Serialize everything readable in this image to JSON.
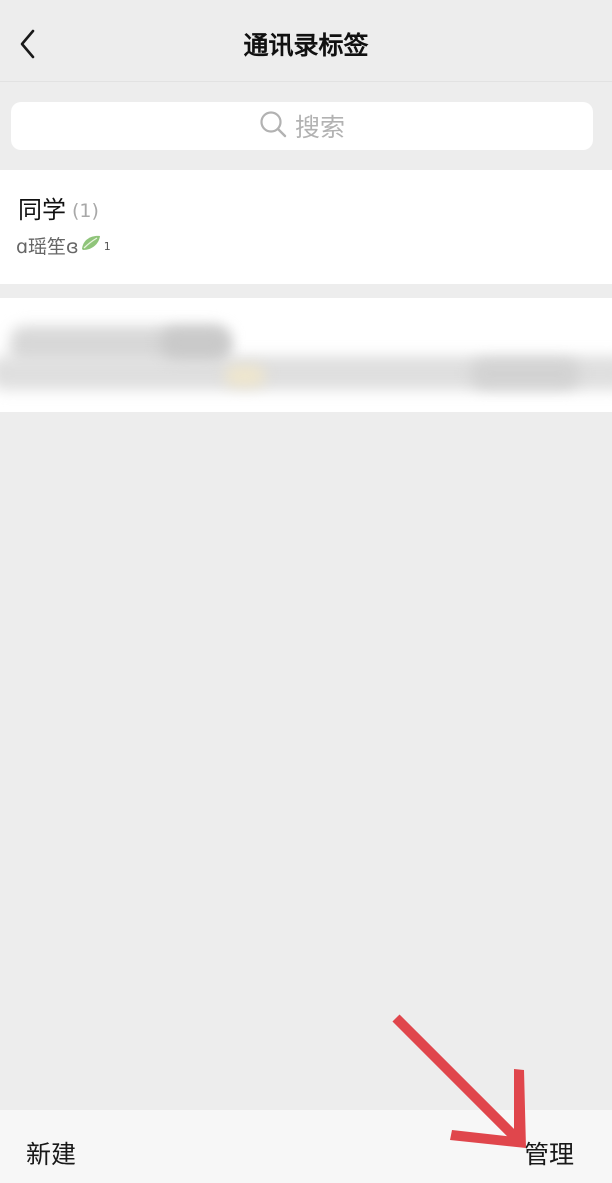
{
  "nav": {
    "title": "通讯录标签",
    "back_icon": "chevron-left-icon"
  },
  "search": {
    "placeholder": "搜索",
    "icon": "search-icon"
  },
  "tags": [
    {
      "name": "同学",
      "count": "(1)",
      "members": "ɑ瑶笙ɞ",
      "member_suffix": "1"
    }
  ],
  "bottom": {
    "new_label": "新建",
    "manage_label": "管理"
  },
  "colors": {
    "background": "#ededed",
    "card": "#ffffff",
    "annotation_arrow": "#e0464c",
    "leaf": "#8fc47a"
  }
}
